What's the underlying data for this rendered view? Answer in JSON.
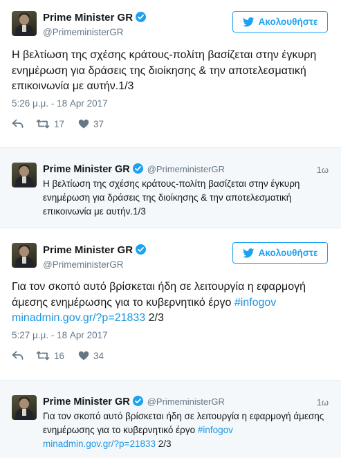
{
  "tweets": [
    {
      "author_name": "Prime Minister GR",
      "handle": "@PrimeministerGR",
      "follow_label": "Ακολουθήστε",
      "text": "Η βελτίωση της σχέσης κράτους-πολίτη βασίζεται στην έγκυρη ενημέρωση για δράσεις της διοίκησης & την αποτελεσματική επικοινωνία με αυτήν.1/3",
      "timestamp": "5:26 μ.μ. - 18 Apr 2017",
      "retweets": "17",
      "likes": "37"
    },
    {
      "author_name": "Prime Minister GR",
      "handle": "@PrimeministerGR",
      "follow_label": "Ακολουθήστε",
      "text_main": "Για τον σκοπό αυτό βρίσκεται ήδη σε λειτουργία η εφαρμογή άμεσης ενημέρωσης για το κυβερνητικό έργο ",
      "hashtag": "#infogov",
      "link": "minadmin.gov.gr/?p=21833",
      "suffix": " 2/3",
      "timestamp": "5:27 μ.μ. - 18 Apr 2017",
      "retweets": "16",
      "likes": "34"
    }
  ],
  "quoted": [
    {
      "author_name": "Prime Minister GR",
      "handle": "@PrimeministerGR",
      "time": "1ω",
      "text": "Η βελτίωση της σχέσης κράτους-πολίτη βασίζεται στην έγκυρη ενημέρωση για δράσεις της διοίκησης & την αποτελεσματική επικοινωνία με αυτήν.1/3"
    },
    {
      "author_name": "Prime Minister GR",
      "handle": "@PrimeministerGR",
      "time": "1ω",
      "text_main": "Για τον σκοπό αυτό βρίσκεται ήδη σε λειτουργία η εφαρμογή άμεσης ενημέρωσης για το κυβερνητικό έργο ",
      "hashtag": "#infogov",
      "link": "minadmin.gov.gr/?p=21833",
      "suffix": " 2/3"
    }
  ],
  "icons": {
    "verified": "verified-badge-icon",
    "bird": "twitter-bird-icon",
    "reply": "reply-icon",
    "retweet": "retweet-icon",
    "like": "heart-icon"
  },
  "colors": {
    "accent": "#1da1f2",
    "link": "#1b95e0",
    "muted": "#657786",
    "reply_bg": "#f5f8fa"
  }
}
